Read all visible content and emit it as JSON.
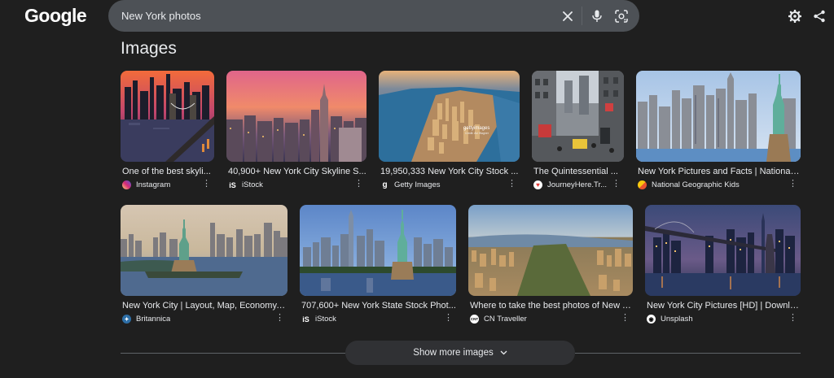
{
  "logo": "Google",
  "search": {
    "value": "New York photos"
  },
  "icons": {
    "clear": "close-icon",
    "voice": "microphone-icon",
    "lens": "lens-icon",
    "settings": "gear-icon",
    "share": "share-icon"
  },
  "section": {
    "heading": "Images"
  },
  "results": [
    {
      "caption": "One of the best skyli...",
      "source": "Instagram",
      "favicon_color": "#d62976"
    },
    {
      "caption": "40,900+ New York City Skyline S...",
      "source": "iStock",
      "favicon_text": "iS"
    },
    {
      "caption": "19,950,333 New York City Stock ...",
      "source": "Getty Images",
      "favicon_text": "g"
    },
    {
      "caption": "The Quintessential ...",
      "source": "JourneyHere.Tr...",
      "favicon_color": "#e53935"
    },
    {
      "caption": "New York Pictures and Facts | National ...",
      "source": "National Geographic Kids",
      "favicon_color": "#f9c80e"
    },
    {
      "caption": "New York City | Layout, Map, Economy, ...",
      "source": "Britannica",
      "favicon_color": "#2e6fa7"
    },
    {
      "caption": "707,600+ New York State Stock Phot...",
      "source": "iStock",
      "favicon_text": "iS"
    },
    {
      "caption": "Where to take the best photos of New Y...",
      "source": "CN Traveller",
      "favicon_text": "CNT"
    },
    {
      "caption": "New York City Pictures [HD] | Downlo...",
      "source": "Unsplash",
      "favicon_color": "#ffffff"
    }
  ],
  "show_more": {
    "label": "Show more images"
  }
}
